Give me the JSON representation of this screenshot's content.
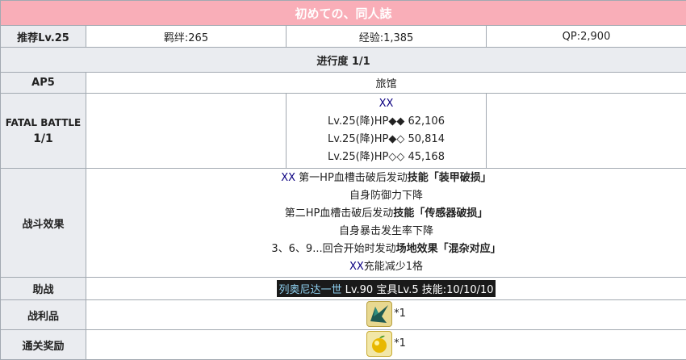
{
  "title": "初めての、同人誌",
  "row_level": {
    "label": "推荐Lv.25",
    "bond": "羁绊:265",
    "exp": "经验:1,385",
    "qp": "QP:2,900"
  },
  "progress": "进行度 1/1",
  "row_ap": {
    "label": "AP5",
    "location": "旅馆"
  },
  "row_fatal": {
    "label_line1": "FATAL BATTLE",
    "label_line2": "1/1",
    "enemy_name": "XX",
    "hp_lines": [
      "Lv.25(降)HP◆◆ 62,106",
      "Lv.25(降)HP◆◇ 50,814",
      "Lv.25(降)HP◇◇ 45,168"
    ]
  },
  "row_effect": {
    "label": "战斗效果",
    "l1_name": "XX",
    "l1_pre": " 第一HP血槽击破后发动",
    "l1_bold": "技能「装甲破损」",
    "l2": "自身防御力下降",
    "l3_pre": "第二HP血槽击破后发动",
    "l3_bold": "技能「传感器破损」",
    "l4": "自身暴击发生率下降",
    "l5_pre": "3、6、9...回合开始时发动",
    "l5_bold": "场地效果「混杂对应」",
    "l6_name": "XX",
    "l6_rest": "充能减少1格"
  },
  "row_support": {
    "label": "助战",
    "servant": "列奥尼达一世",
    "detail": " Lv.90 宝具Lv.5 技能:10/10/10"
  },
  "row_drop": {
    "label": "战利品",
    "icon": "wing-material-icon",
    "count": "*1"
  },
  "row_clear": {
    "label": "通关奖励",
    "icon": "golden-fruit-icon",
    "count": "*1"
  },
  "colors": {
    "title_bg": "#f9aeb8",
    "header_bg": "#eaecf0",
    "border": "#a2a9b1",
    "link_blue": "#0b0080"
  }
}
